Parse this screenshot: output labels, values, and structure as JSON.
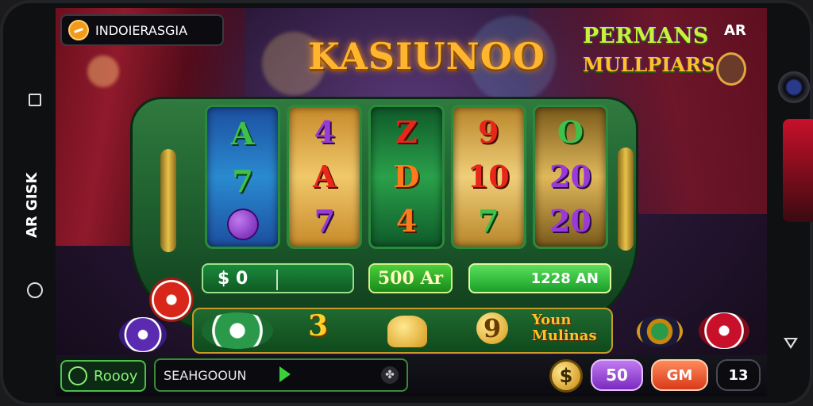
{
  "device": {
    "side_label": "AR GISK"
  },
  "header": {
    "region_label": "INDOIERASGIA",
    "title": "KASIUNOO",
    "promo_line1": "PERMANS",
    "promo_line2": "MULLPIARS",
    "promo_badge": "AR"
  },
  "reels": [
    {
      "symbols": [
        "A",
        "7",
        "grape"
      ]
    },
    {
      "symbols": [
        "4",
        "A",
        "7"
      ]
    },
    {
      "symbols": [
        "Z",
        "D",
        "4"
      ]
    },
    {
      "symbols": [
        "9",
        "10",
        "7"
      ]
    },
    {
      "symbols": [
        "O",
        "20",
        "20"
      ]
    }
  ],
  "meters": {
    "bet_value": "$ 0",
    "win_value": "500 Ar",
    "credit_value": "1228 AN"
  },
  "tray": {
    "item_3": "3",
    "item_9": "9",
    "badge_line1": "Youn",
    "badge_line2": "Mulinas"
  },
  "bottom": {
    "ready_label": "Roooy",
    "search_value": "SEAHGOOUN",
    "coin_glyph": "$",
    "btn_50": "50",
    "btn_gm": "GM",
    "btn_13": "13"
  },
  "colors": {
    "machine_green": "#1c5a2c",
    "title_gold": "#ffb62e",
    "accent_purple": "#9a3ad8",
    "accent_red": "#d83a1a"
  }
}
